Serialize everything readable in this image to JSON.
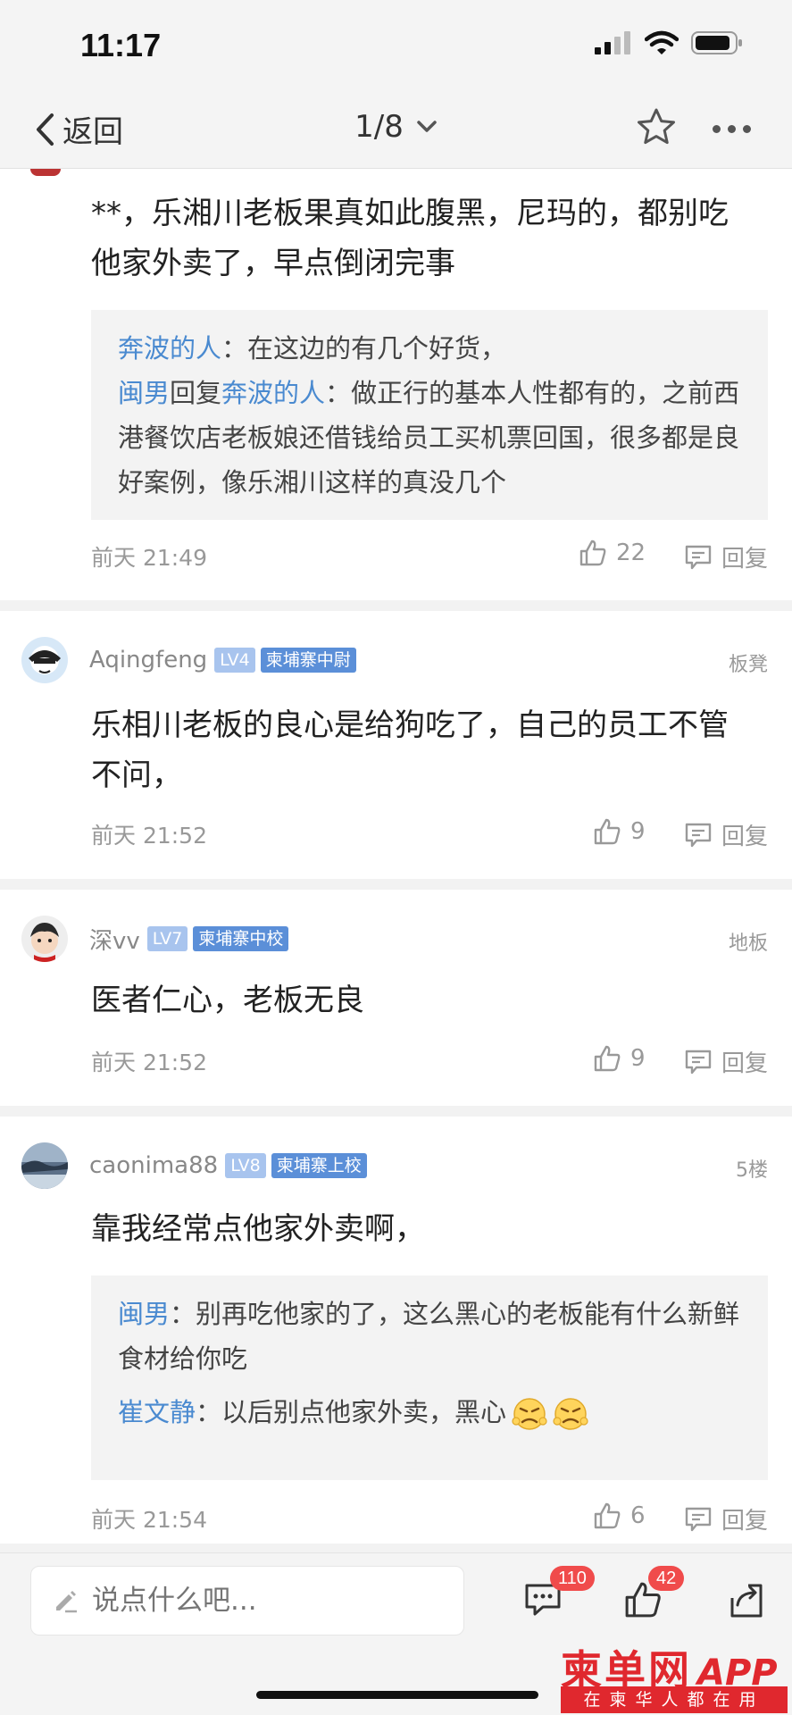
{
  "status": {
    "time": "11:17"
  },
  "nav": {
    "back": "返回",
    "pager": "1/8"
  },
  "posts": [
    {
      "text": "**，乐湘川老板果真如此腹黑，尼玛的，都别吃他家外卖了，早点倒闭完事",
      "quotes": [
        {
          "name": "奔波的人",
          "sep": "：",
          "text": "在这边的有几个好货，"
        },
        {
          "name": "闽男",
          "mid": "回复",
          "name2": "奔波的人",
          "sep": "：",
          "text": "做正行的基本人性都有的，之前西港餐饮店老板娘还借钱给员工买机票回国，很多都是良好案例，像乐湘川这样的真没几个"
        }
      ],
      "time": "前天 21:49",
      "likes": "22",
      "reply": "回复"
    },
    {
      "user": "Aqingfeng",
      "level": "LV4",
      "rank": "柬埔寨中尉",
      "floor": "板凳",
      "text": "乐相川老板的良心是给狗吃了，自己的员工不管不问，",
      "time": "前天 21:52",
      "likes": "9",
      "reply": "回复"
    },
    {
      "user": "深vv",
      "level": "LV7",
      "rank": "柬埔寨中校",
      "floor": "地板",
      "text": "医者仁心，老板无良",
      "time": "前天 21:52",
      "likes": "9",
      "reply": "回复"
    },
    {
      "user": "caonima88",
      "level": "LV8",
      "rank": "柬埔寨上校",
      "floor": "5楼",
      "text": "靠我经常点他家外卖啊，",
      "quotes": [
        {
          "name": "闽男",
          "sep": "：",
          "text": "别再吃他家的了，这么黑心的老板能有什么新鲜食材给你吃"
        },
        {
          "name": "崔文静",
          "sep": "：",
          "text": "以后别点他家外卖，黑心"
        }
      ],
      "time": "前天 21:54",
      "likes": "6",
      "reply": "回复"
    }
  ],
  "bottom": {
    "placeholder": "说点什么吧...",
    "comments_badge": "110",
    "likes_badge": "42"
  },
  "brand": {
    "main": "柬单网",
    "app": "APP",
    "slogan": "在柬华人都在用"
  }
}
